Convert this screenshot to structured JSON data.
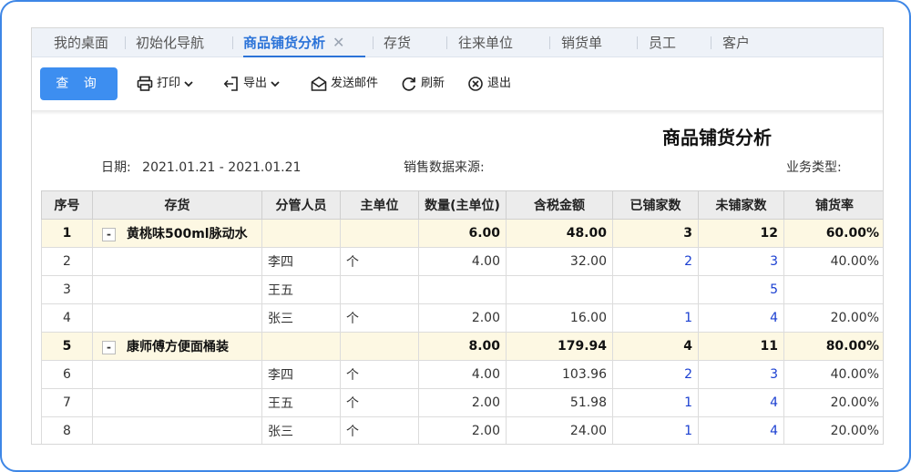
{
  "tabs": [
    {
      "label": "我的桌面"
    },
    {
      "label": "初始化导航"
    },
    {
      "label": "商品铺货分析",
      "active": true,
      "closable": true
    },
    {
      "label": "存货"
    },
    {
      "label": "往来单位"
    },
    {
      "label": "销货单"
    },
    {
      "label": "员工"
    },
    {
      "label": "客户"
    }
  ],
  "tab_close_glyph": "✕",
  "toolbar": {
    "query": "查 询",
    "print": "打印",
    "export": "导出",
    "email": "发送邮件",
    "refresh": "刷新",
    "exit": "退出"
  },
  "report": {
    "title": "商品铺货分析",
    "date_label": "日期:",
    "date_value": "2021.01.21 - 2021.01.21",
    "source_label": "销售数据来源:",
    "biz_type_label": "业务类型:"
  },
  "table": {
    "columns": [
      "序号",
      "存货",
      "分管人员",
      "主单位",
      "数量(主单位)",
      "含税金额",
      "已铺家数",
      "未铺家数",
      "铺货率"
    ],
    "rows": [
      {
        "group": true,
        "seq": "1",
        "item": "黄桃味500ml脉动水",
        "staff": "",
        "unit": "",
        "qty": "6.00",
        "amount": "48.00",
        "covered": "3",
        "uncovered": "12",
        "rate": "60.00%"
      },
      {
        "group": false,
        "seq": "2",
        "item": "",
        "staff": "李四",
        "unit": "个",
        "qty": "4.00",
        "amount": "32.00",
        "covered": "2",
        "uncovered": "3",
        "rate": "40.00%"
      },
      {
        "group": false,
        "seq": "3",
        "item": "",
        "staff": "王五",
        "unit": "",
        "qty": "",
        "amount": "",
        "covered": "",
        "uncovered": "5",
        "rate": ""
      },
      {
        "group": false,
        "seq": "4",
        "item": "",
        "staff": "张三",
        "unit": "个",
        "qty": "2.00",
        "amount": "16.00",
        "covered": "1",
        "uncovered": "4",
        "rate": "20.00%"
      },
      {
        "group": true,
        "seq": "5",
        "item": "康师傅方便面桶装",
        "staff": "",
        "unit": "",
        "qty": "8.00",
        "amount": "179.94",
        "covered": "4",
        "uncovered": "11",
        "rate": "80.00%"
      },
      {
        "group": false,
        "seq": "6",
        "item": "",
        "staff": "李四",
        "unit": "个",
        "qty": "4.00",
        "amount": "103.96",
        "covered": "2",
        "uncovered": "3",
        "rate": "40.00%"
      },
      {
        "group": false,
        "seq": "7",
        "item": "",
        "staff": "王五",
        "unit": "个",
        "qty": "2.00",
        "amount": "51.98",
        "covered": "1",
        "uncovered": "4",
        "rate": "20.00%"
      },
      {
        "group": false,
        "seq": "8",
        "item": "",
        "staff": "张三",
        "unit": "个",
        "qty": "2.00",
        "amount": "24.00",
        "covered": "1",
        "uncovered": "4",
        "rate": "20.00%"
      }
    ],
    "collapse_glyph": "-"
  },
  "colors": {
    "accent": "#3d8ef0",
    "frame_border": "#3d86e6",
    "group_row_bg": "#fdf8e3",
    "link_number": "#1a3fd1"
  }
}
